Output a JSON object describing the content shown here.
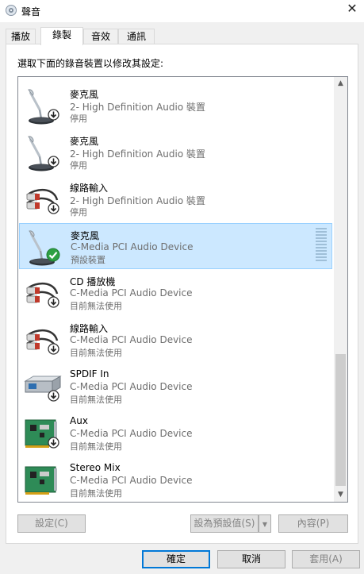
{
  "window": {
    "title": "聲音"
  },
  "tabs": [
    {
      "label": "播放"
    },
    {
      "label": "錄製"
    },
    {
      "label": "音效"
    },
    {
      "label": "通訊"
    }
  ],
  "instruction": "選取下面的錄音裝置以修改其設定:",
  "devices": [
    {
      "name": "麥克風",
      "desc": "2- High Definition Audio 裝置",
      "status": "停用",
      "icon": "microphone-icon",
      "badge": "down-arrow"
    },
    {
      "name": "麥克風",
      "desc": "2- High Definition Audio 裝置",
      "status": "停用",
      "icon": "microphone-icon",
      "badge": "down-arrow"
    },
    {
      "name": "線路輸入",
      "desc": "2- High Definition Audio 裝置",
      "status": "停用",
      "icon": "rca-cable-icon",
      "badge": "down-arrow"
    },
    {
      "name": "麥克風",
      "desc": "C-Media PCI Audio Device",
      "status": "預設裝置",
      "icon": "microphone-icon",
      "badge": "green-check"
    },
    {
      "name": "CD 播放機",
      "desc": "C-Media PCI Audio Device",
      "status": "目前無法使用",
      "icon": "rca-cable-icon",
      "badge": "down-arrow"
    },
    {
      "name": "線路輸入",
      "desc": "C-Media PCI Audio Device",
      "status": "目前無法使用",
      "icon": "rca-cable-icon",
      "badge": "down-arrow"
    },
    {
      "name": "SPDIF In",
      "desc": "C-Media PCI Audio Device",
      "status": "目前無法使用",
      "icon": "spdif-device-icon",
      "badge": "down-arrow"
    },
    {
      "name": "Aux",
      "desc": "C-Media PCI Audio Device",
      "status": "目前無法使用",
      "icon": "sound-card-icon",
      "badge": "down-arrow"
    },
    {
      "name": "Stereo Mix",
      "desc": "C-Media PCI Audio Device",
      "status": "目前無法使用",
      "icon": "sound-card-icon",
      "badge": "none"
    }
  ],
  "buttons": {
    "configure": "設定(C)",
    "set_default": "設為預設值(S)",
    "properties": "內容(P)",
    "ok": "確定",
    "cancel": "取消",
    "apply": "套用(A)"
  }
}
